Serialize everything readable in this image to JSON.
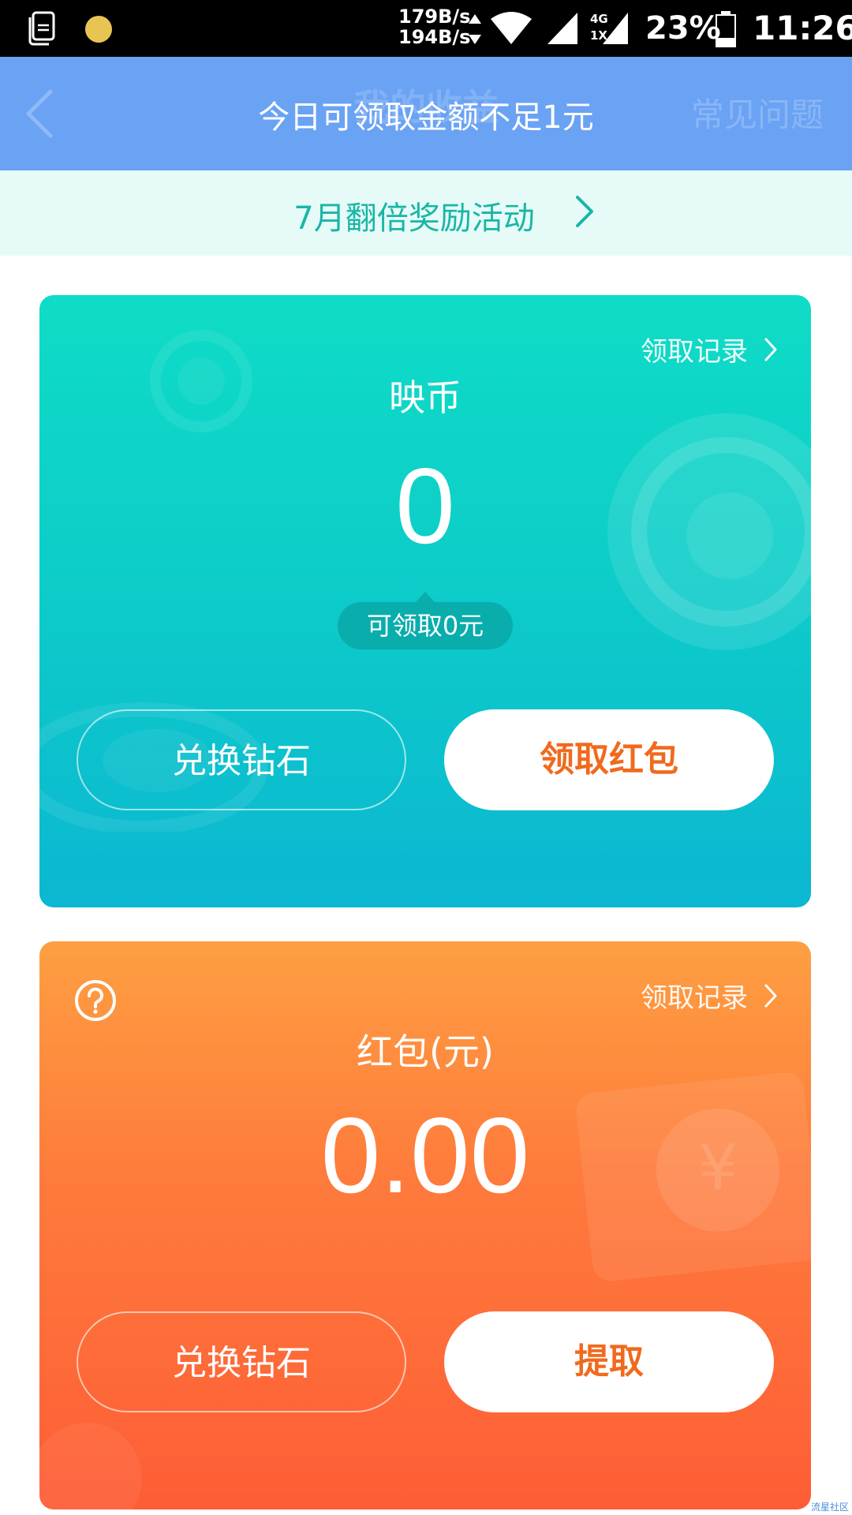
{
  "status_bar": {
    "speed_up": "179B/s",
    "speed_down": "194B/s",
    "net_type": "4G",
    "net_sub": "1X",
    "battery": "23%",
    "time": "11:26"
  },
  "header": {
    "title": "我的收益",
    "toast": "今日可领取金额不足1元",
    "faq_label": "常见问题"
  },
  "promo": {
    "label": "7月翻倍奖励活动"
  },
  "coin_card": {
    "record_label": "领取记录",
    "title": "映币",
    "amount": "0",
    "claimable": "可领取0元",
    "exchange_label": "兑换钻石",
    "claim_label": "领取红包",
    "claim_color": "#f06a1e"
  },
  "redpacket_card": {
    "record_label": "领取记录",
    "title": "红包(元)",
    "amount": "0.00",
    "exchange_label": "兑换钻石",
    "withdraw_label": "提取",
    "withdraw_color": "#f06a1e"
  },
  "watermark": "流星社区",
  "colors": {
    "header_bg": "#6aa2f4",
    "promo_bg": "#e6fbf8",
    "promo_text": "#19b6a6",
    "coin_card_top": "#0fdcc6",
    "coin_card_bottom": "#0bb7d1",
    "red_card_top": "#fe9f42",
    "red_card_bottom": "#fe5d36"
  }
}
